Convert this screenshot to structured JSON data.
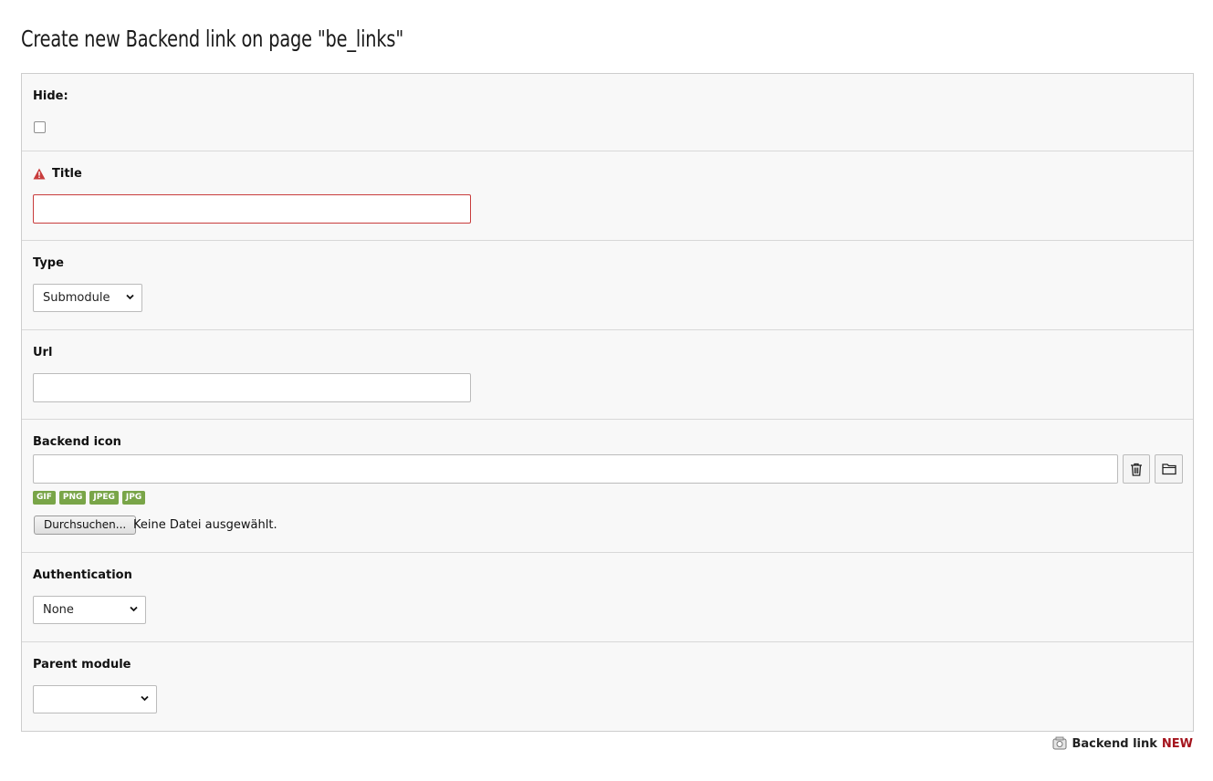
{
  "page": {
    "title": "Create new Backend link on page \"be_links\""
  },
  "fields": {
    "hide": {
      "label": "Hide:",
      "checked": false
    },
    "title": {
      "label": "Title",
      "value": "",
      "required": true
    },
    "type": {
      "label": "Type",
      "selected": "Submodule"
    },
    "url": {
      "label": "Url",
      "value": ""
    },
    "backend_icon": {
      "label": "Backend icon",
      "value": "",
      "allowed_types": [
        "GIF",
        "PNG",
        "JPEG",
        "JPG"
      ],
      "browse_label": "Durchsuchen...",
      "file_status": "Keine Datei ausgewählt."
    },
    "authentication": {
      "label": "Authentication",
      "selected": "None"
    },
    "parent_module": {
      "label": "Parent module",
      "selected": ""
    }
  },
  "footer": {
    "record_type": "Backend link",
    "status": "NEW"
  },
  "colors": {
    "badge": "#79a548",
    "error": "#c83c3c",
    "new": "#a4141d"
  },
  "icons": [
    "warning-icon",
    "trash-icon",
    "folder-icon",
    "chevron-down-icon",
    "record-icon"
  ]
}
